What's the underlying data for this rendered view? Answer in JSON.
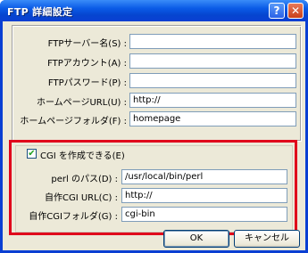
{
  "window": {
    "title": "FTP 詳細設定",
    "help_glyph": "?",
    "close_glyph": "✕"
  },
  "ftp_section": {
    "fields": [
      {
        "label": "FTPサーバー名(S) :",
        "value": ""
      },
      {
        "label": "FTPアカウント(A) :",
        "value": ""
      },
      {
        "label": "FTPパスワード(P) :",
        "value": ""
      },
      {
        "label": "ホームページURL(U) :",
        "value": "http://"
      },
      {
        "label": "ホームページフォルダ(F) :",
        "value": "homepage"
      }
    ]
  },
  "cgi_section": {
    "checkbox_label": "CGI を作成できる(E)",
    "checked": true,
    "fields": [
      {
        "label": "perl のパス(D) :",
        "value": "/usr/local/bin/perl"
      },
      {
        "label": "自作CGI URL(C) :",
        "value": "http://"
      },
      {
        "label": "自作CGIフォルダ(G) :",
        "value": "cgi-bin"
      }
    ]
  },
  "buttons": {
    "ok": "OK",
    "cancel": "キャンセル"
  },
  "colors": {
    "highlight_border": "#e0001b",
    "titlebar": "#0a5ae6"
  }
}
